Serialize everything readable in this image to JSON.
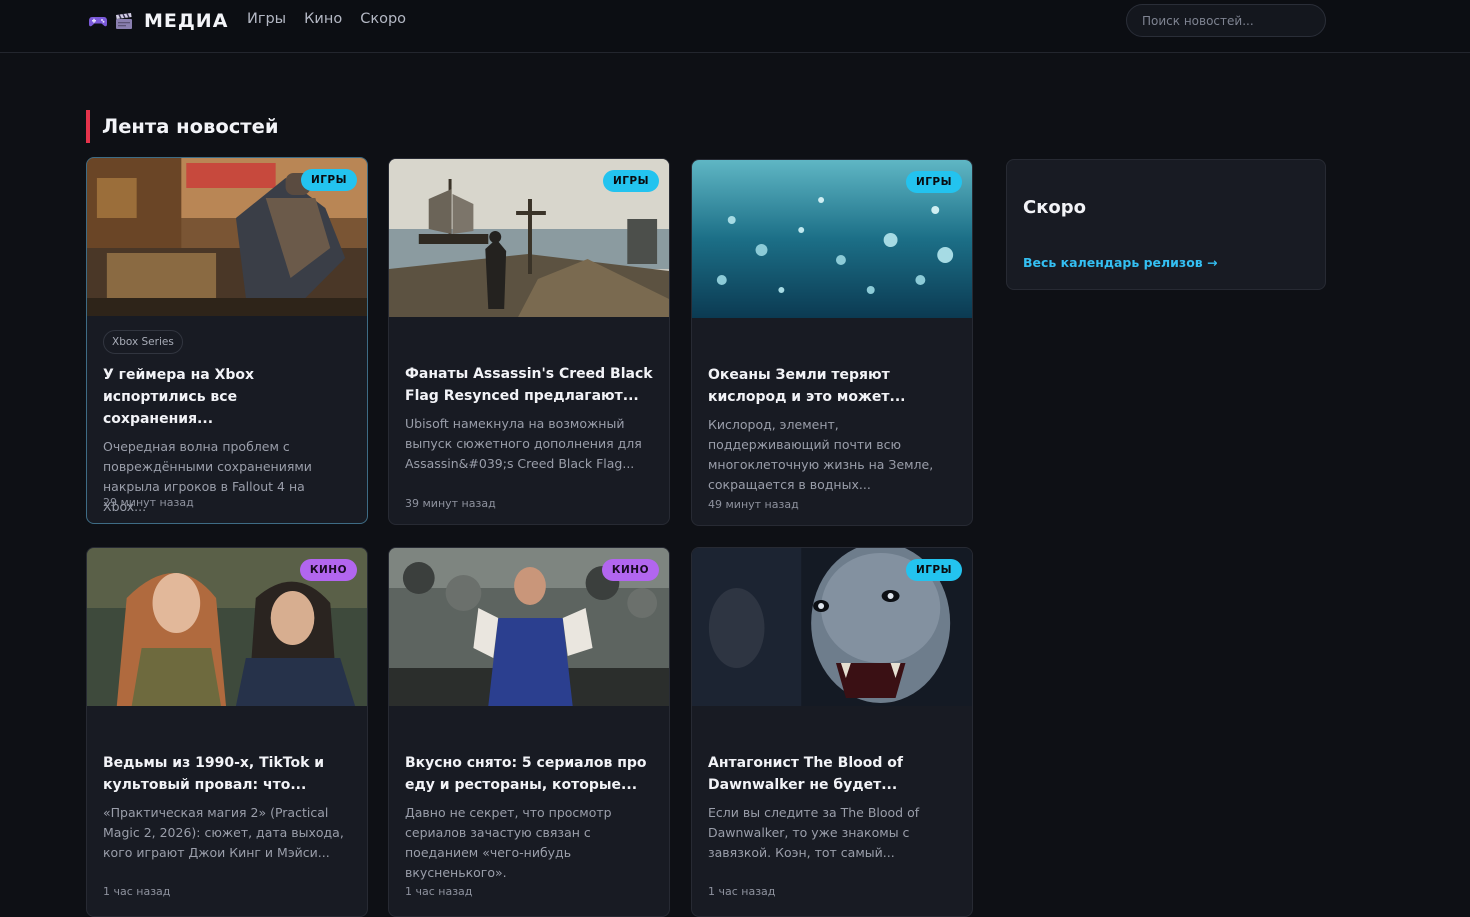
{
  "header": {
    "logo_text": "МЕДИА",
    "nav": [
      "Игры",
      "Кино",
      "Скоро"
    ],
    "search_placeholder": "Поиск новостей..."
  },
  "feed": {
    "title": "Лента новостей",
    "cards": [
      {
        "badge": "ИГРЫ",
        "tag": "Xbox Series",
        "title": "У геймера на Xbox испортились все сохранения...",
        "desc": "Очередная волна проблем с повреждёнными сохранениями накрыла игроков в Fallout 4 на Xbox...",
        "time": "29 минут назад"
      },
      {
        "badge": "ИГРЫ",
        "title": "Фанаты Assassin's Creed Black Flag Resynced предлагают...",
        "desc": "Ubisoft намекнула на возможный выпуск сюжетного дополнения для Assassin&#039;s Creed Black Flag...",
        "time": "39 минут назад"
      },
      {
        "badge": "ИГРЫ",
        "title": "Океаны Земли теряют кислород и это может...",
        "desc": "Кислород, элемент, поддерживающий почти всю многоклеточную жизнь на Земле, сокращается в водных...",
        "time": "49 минут назад"
      },
      {
        "badge": "КИНО",
        "title": "Ведьмы из 1990-х, TikTok и культовый провал: что...",
        "desc": "«Практическая магия 2» (Practical Magic 2, 2026): сюжет, дата выхода, кого играют Джои Кинг и Мэйси...",
        "time": "1 час назад"
      },
      {
        "badge": "КИНО",
        "title": "Вкусно снято: 5 сериалов про еду и рестораны, которые...",
        "desc": "Давно не секрет, что просмотр сериалов зачастую связан с поеданием «чего-нибудь вкусненького».",
        "time": "1 час назад"
      },
      {
        "badge": "ИГРЫ",
        "title": "Антагонист The Blood of Dawnwalker не будет...",
        "desc": "Если вы следите за The Blood of Dawnwalker, то уже знакомы с завязкой. Коэн, тот самый...",
        "time": "1 час назад"
      }
    ]
  },
  "aside": {
    "title": "Скоро",
    "link": "Весь календарь релизов →"
  },
  "colors": {
    "accent_red": "#e5334b",
    "games_badge": "#23c3ef",
    "movies_badge": "#b266ef",
    "link": "#34bff2"
  },
  "icons": [
    "gamepad-icon",
    "clapperboard-icon"
  ]
}
